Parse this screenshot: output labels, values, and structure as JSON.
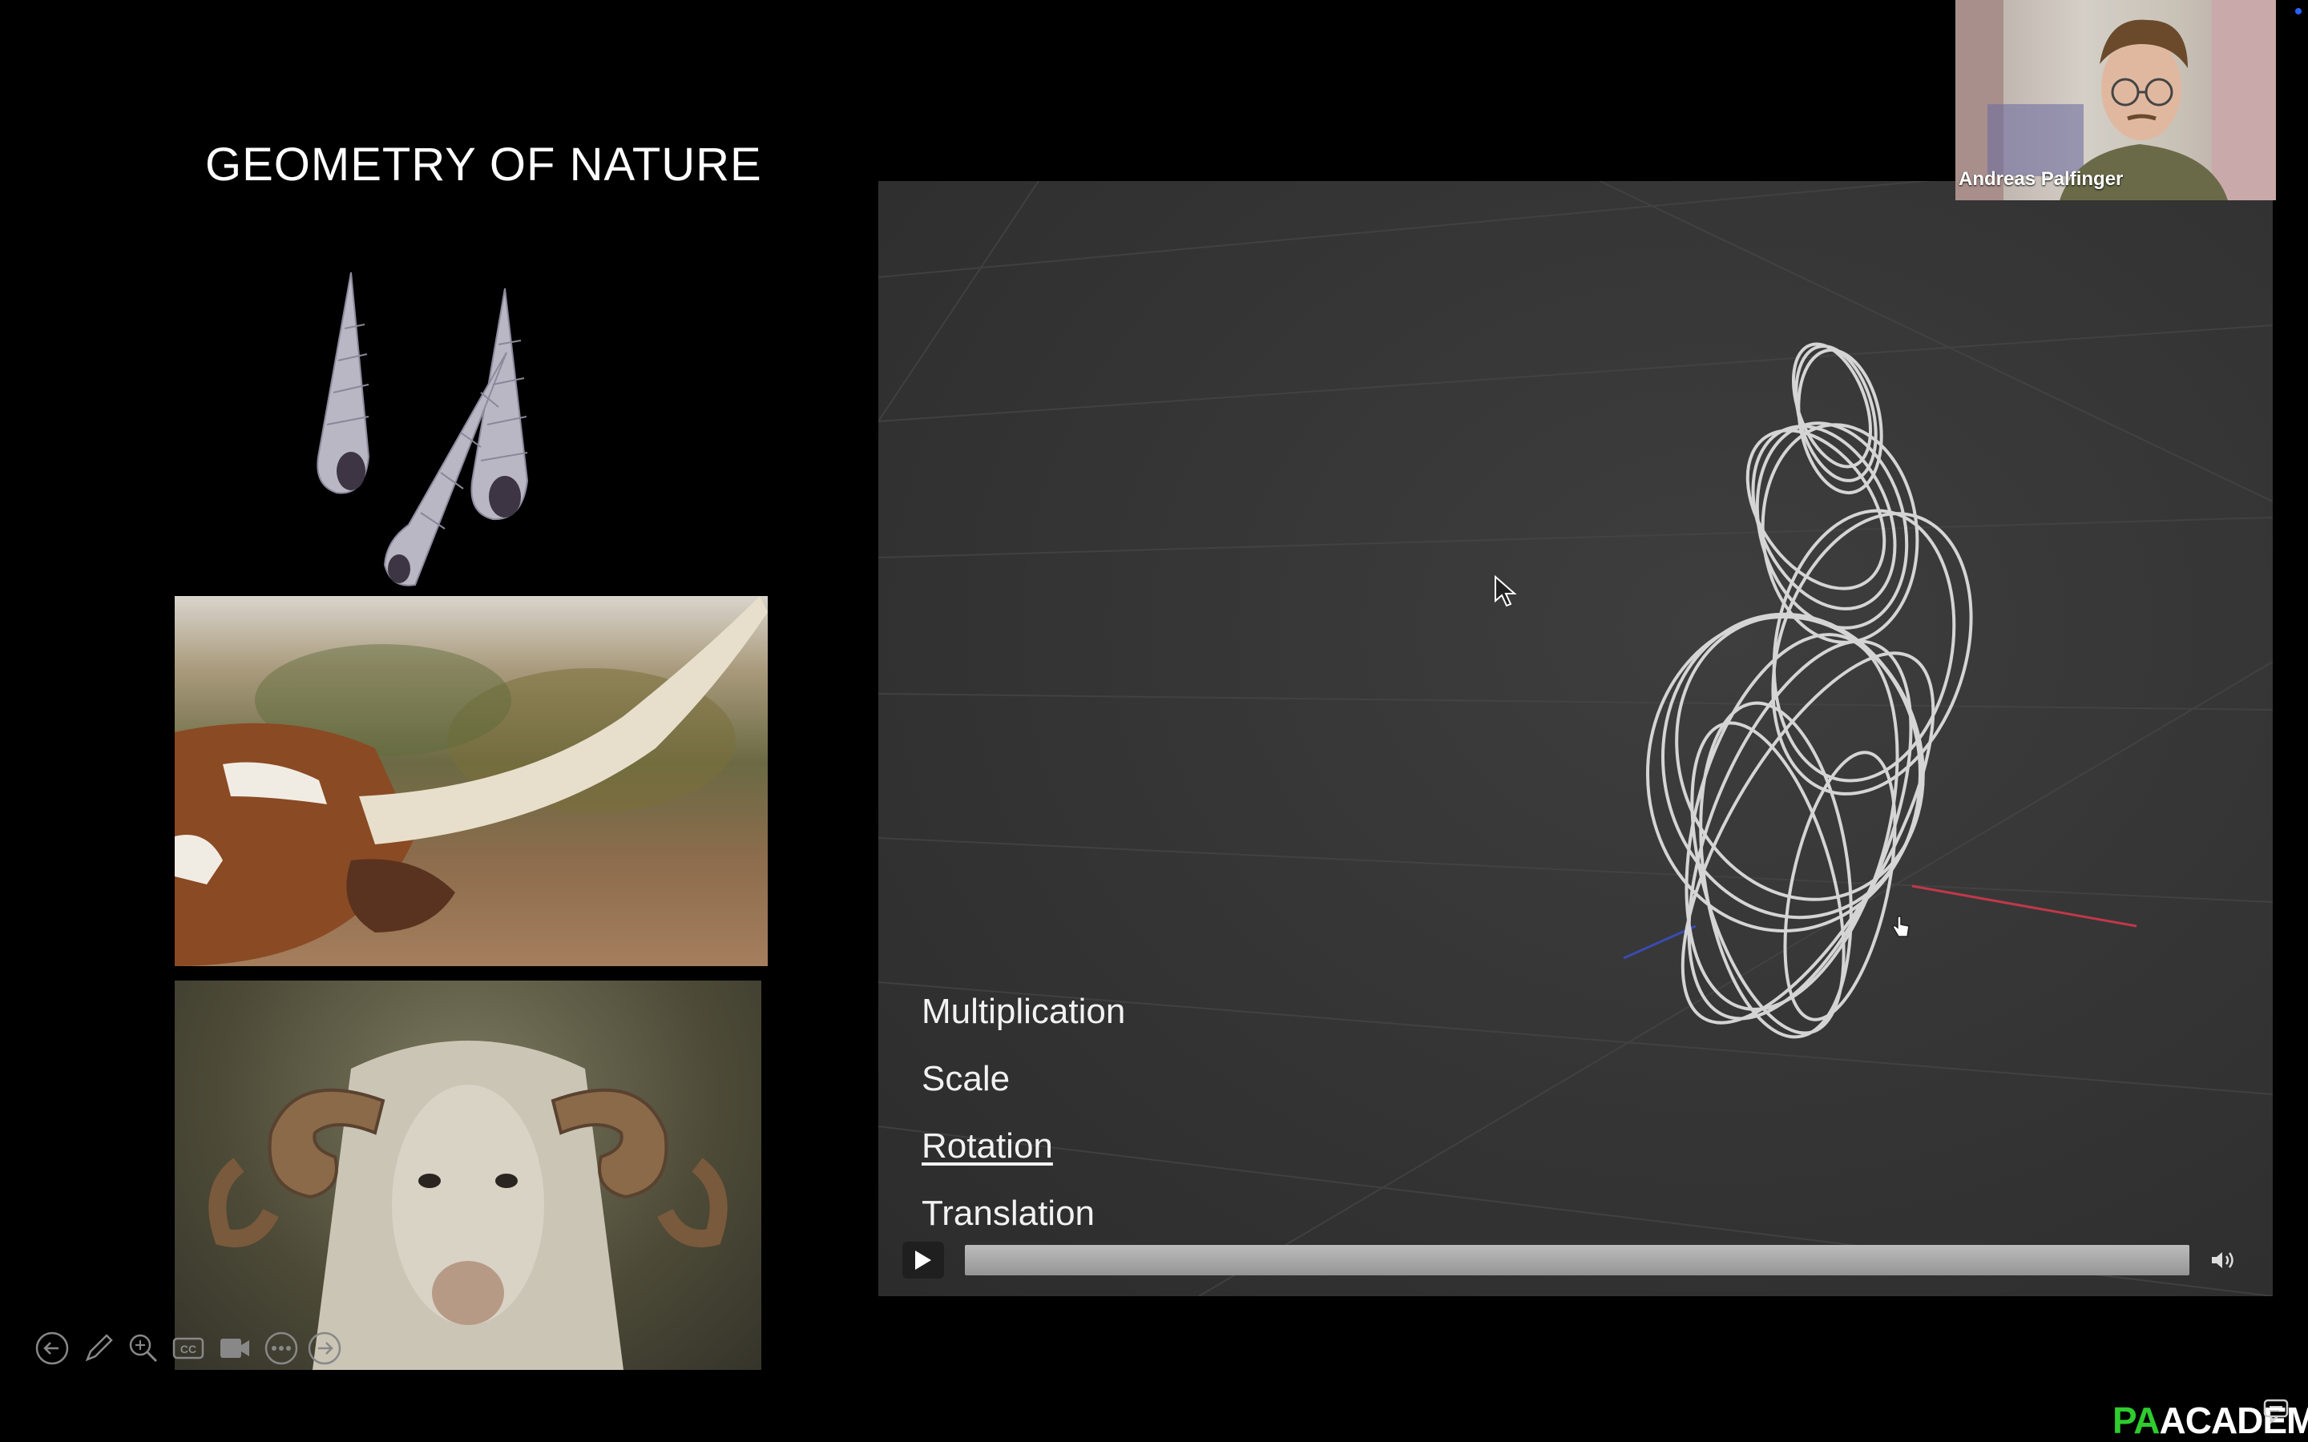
{
  "slide": {
    "title": "GEOMETRY OF NATURE"
  },
  "video": {
    "labels": {
      "multiplication": "Multiplication",
      "scale": "Scale",
      "rotation": "Rotation",
      "translation": "Translation"
    },
    "controls": {
      "play_icon": "play-icon",
      "volume_icon": "volume-icon",
      "progress": 0
    }
  },
  "speaker": {
    "name": "Andreas Palfinger"
  },
  "toolbar": {
    "icons": [
      "back-arrow-icon",
      "pen-icon",
      "zoom-icon",
      "captions-icon",
      "camera-icon",
      "more-icon",
      "forward-arrow-icon"
    ]
  },
  "brand": {
    "part1": "PA",
    "part2": "ACADEMY"
  },
  "colors": {
    "brand_green": "#2ecc2e",
    "background": "#000000",
    "video_bg": "#343434"
  }
}
